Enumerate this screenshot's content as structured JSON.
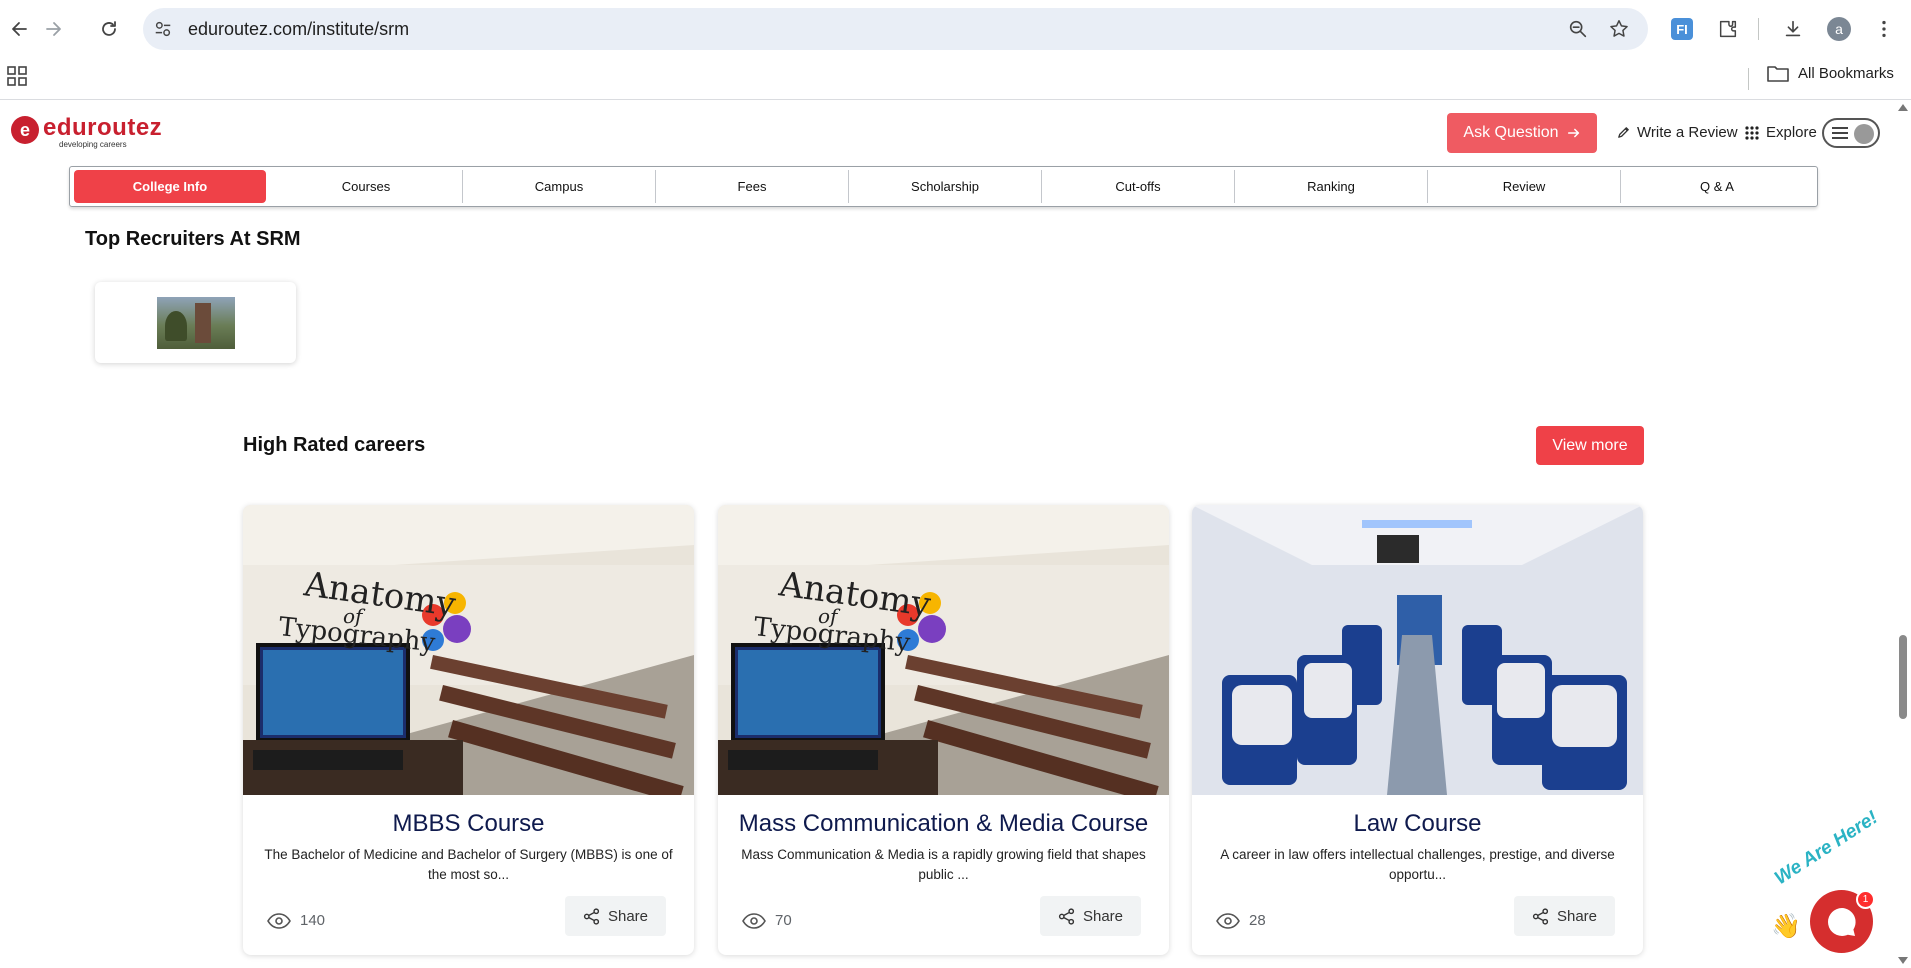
{
  "browser": {
    "url": "eduroutez.com/institute/srm",
    "extension_label": "FI",
    "profile_initial": "a",
    "bookmarks_label": "All Bookmarks"
  },
  "site": {
    "logo_name": "eduroutez",
    "logo_tagline": "developing careers",
    "ask_question": "Ask Question",
    "write_review": "Write a Review",
    "explore": "Explore"
  },
  "tabs": [
    "College Info",
    "Courses",
    "Campus",
    "Fees",
    "Scholarship",
    "Cut-offs",
    "Ranking",
    "Review",
    "Q & A"
  ],
  "recruiters": {
    "title": "Top Recruiters At SRM"
  },
  "careers": {
    "title": "High Rated careers",
    "view_more": "View more",
    "share_label": "Share",
    "cards": [
      {
        "title": "MBBS Course",
        "description": "The Bachelor of Medicine and Bachelor of Surgery (MBBS) is one of the most so...",
        "views": "140",
        "image_text_1": "Anatomy",
        "image_text_2": "of",
        "image_text_3": "Typography"
      },
      {
        "title": "Mass Communication & Media Course",
        "description": "Mass Communication & Media is a rapidly growing field that shapes public ...",
        "views": "70",
        "image_text_1": "Anatomy",
        "image_text_2": "of",
        "image_text_3": "Typography"
      },
      {
        "title": "Law Course",
        "description": "A career in law offers intellectual challenges, prestige, and diverse opportu...",
        "views": "28"
      }
    ]
  },
  "chat": {
    "label": "We Are Here!",
    "badge": "1"
  },
  "colors": {
    "brand_red": "#ef4148",
    "ask_button": "#ef5b62",
    "card_title": "#0f1a4d",
    "omnibox": "#e9eef6"
  }
}
